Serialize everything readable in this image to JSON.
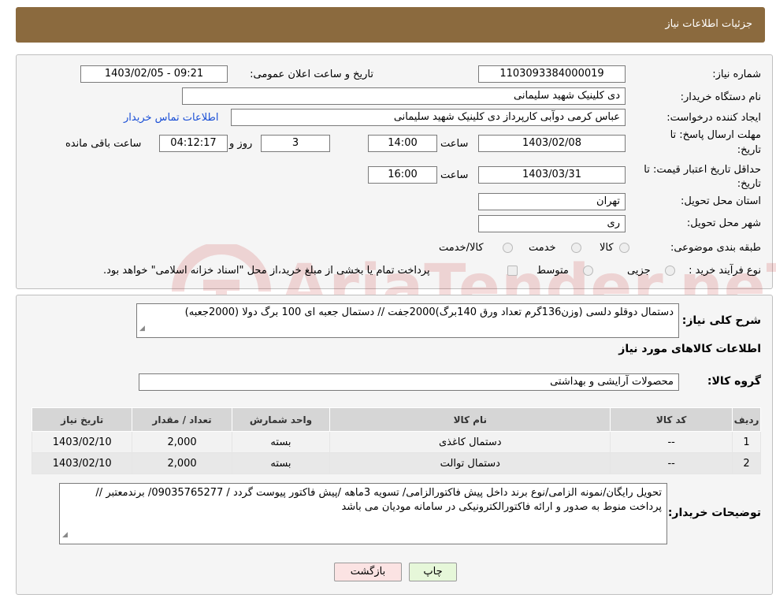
{
  "header": {
    "title": "جزئیات اطلاعات نیاز"
  },
  "watermark": {
    "text": "AriaTender.neT"
  },
  "form": {
    "need_number_label": "شماره نیاز:",
    "need_number": "1103093384000019",
    "announce_label": "تاریخ و ساعت اعلان عمومی:",
    "announce_value": "1403/02/05 - 09:21",
    "buyer_org_label": "نام دستگاه خریدار:",
    "buyer_org": "دی کلینیک شهید سلیمانی",
    "requester_label": "ایجاد کننده درخواست:",
    "requester": "عباس کرمی دوآبی کارپرداز دی کلینیک شهید سلیمانی",
    "contact_link": "اطلاعات تماس خریدار",
    "deadline_label_1": "مهلت ارسال پاسخ: تا",
    "deadline_label_2": "تاریخ:",
    "deadline_date": "1403/02/08",
    "time_label": "ساعت",
    "deadline_time": "14:00",
    "days_value": "3",
    "days_label": "روز و",
    "remaining_time": "04:12:17",
    "remaining_label": "ساعت باقی مانده",
    "validity_label_1": "حداقل تاریخ اعتبار قیمت: تا",
    "validity_label_2": "تاریخ:",
    "validity_date": "1403/03/31",
    "validity_time_label": "ساعت",
    "validity_time": "16:00",
    "province_label": "استان محل تحویل:",
    "province": "تهران",
    "city_label": "شهر محل تحویل:",
    "city": "ری",
    "category_label": "طبقه بندی موضوعی:",
    "category_options": [
      "کالا",
      "خدمت",
      "کالا/خدمت"
    ],
    "process_label": "نوع فرآیند خرید :",
    "process_options": [
      "جزیی",
      "متوسط"
    ],
    "process_note": "پرداخت تمام یا بخشی از مبلغ خرید،از محل \"اسناد خزانه اسلامی\" خواهد بود."
  },
  "details": {
    "summary_label": "شرح کلی نیاز:",
    "summary_text": "دستمال دوقلو دلسی (وزن136گرم تعداد ورق 140برگ)2000جفت // دستمال جعبه ای 100 برگ دولا (2000جعبه)",
    "goods_info_title": "اطلاعات کالاهای مورد نیاز",
    "goods_group_label": "گروه کالا:",
    "goods_group": "محصولات آرایشی و بهداشتی",
    "table": {
      "headers": [
        "ردیف",
        "کد کالا",
        "نام کالا",
        "واحد شمارش",
        "تعداد / مقدار",
        "تاریخ نیاز"
      ],
      "rows": [
        [
          "1",
          "--",
          "دستمال کاغذی",
          "بسته",
          "2,000",
          "1403/02/10"
        ],
        [
          "2",
          "--",
          "دستمال توالت",
          "بسته",
          "2,000",
          "1403/02/10"
        ]
      ]
    },
    "buyer_notes_label": "توضیحات خریدار:",
    "buyer_notes": "تحویل رایگان/نمونه الزامی/نوع برند داخل پیش فاکتورالزامی/ تسویه 3ماهه /پیش فاکتور پیوست گردد / 09035765277/ برندمعتبر // پرداخت منوط به صدور و ارائه فاکتورالکترونیکی در سامانه مودیان می باشد"
  },
  "buttons": {
    "print": "چاپ",
    "back": "بازگشت"
  },
  "colors": {
    "header_bg": "#8b6a3e",
    "link": "#1a4fd6",
    "print_bg": "#e6f7d9",
    "back_bg": "#fbe3e3"
  }
}
